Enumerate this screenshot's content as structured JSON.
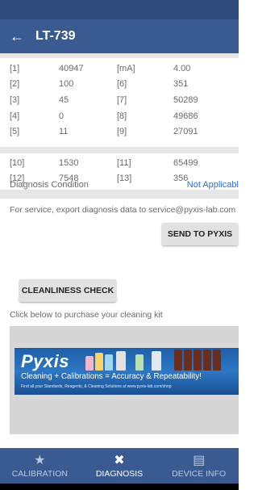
{
  "app": {
    "title": "LT-739"
  },
  "params_block1": [
    [
      "[1]",
      "40947",
      "[mA]",
      "4.00"
    ],
    [
      "[2]",
      "100",
      "[6]",
      "351"
    ],
    [
      "[3]",
      "45",
      "[7]",
      "50289"
    ],
    [
      "[4]",
      "0",
      "[8]",
      "49686"
    ],
    [
      "[5]",
      "11",
      "[9]",
      "27091"
    ]
  ],
  "params_block2": [
    [
      "[10]",
      "1530",
      "[11]",
      "65499"
    ],
    [
      "[12]",
      "7548",
      "[13]",
      "356"
    ]
  ],
  "diagnosis": {
    "label": "Diagnosis Condition",
    "value": "Not Applicabl"
  },
  "service": {
    "text": "For service, export diagnosis data to service@pyxis-lab.com",
    "button": "SEND TO PYXIS"
  },
  "cleanliness": {
    "button": "CLEANLINESS CHECK",
    "purchase_text": "Click below to purchase your cleaning kit"
  },
  "ad": {
    "logo": "Pyxis",
    "tagline": "Cleaning + Calibrations = Accuracy & Repeatability!",
    "small": "Find all your Standards, Reagents, & Cleaning Solutions at www.pyxis-lab.com/shop"
  },
  "nav": [
    {
      "label": "CALIBRATION",
      "icon": "star-icon"
    },
    {
      "label": "DIAGNOSIS",
      "icon": "tools-icon",
      "active": true
    },
    {
      "label": "DEVICE INFO",
      "icon": "document-icon"
    }
  ],
  "colors": {
    "primary": "#3a5a92",
    "status": "#2e4a7a",
    "link": "#2f6fd3",
    "divider": "#e6e6e6"
  }
}
